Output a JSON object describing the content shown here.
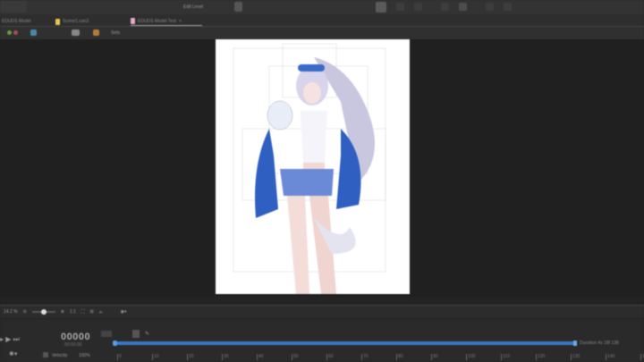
{
  "toolbar": {
    "edit_level": "Edit Level"
  },
  "tabs": [
    {
      "label": "EDUDS Model",
      "color": "#888888"
    },
    {
      "label": "Scene1.can3",
      "color": "#e8c84a"
    },
    {
      "label": "EDUDS Model Test",
      "color": "#e8a8c8",
      "active": true
    }
  ],
  "subbar": {
    "label": "Sets"
  },
  "zoombar": {
    "zoom": "14.2 %",
    "actual_size": "1:1"
  },
  "timeline": {
    "frame": "00000",
    "time": "00:00:00",
    "velocity_label": "Velocity",
    "velocity": "100%",
    "duration": "Duration 4s 18f  138",
    "ticks": [
      "0",
      "10",
      "20",
      "30",
      "40",
      "50",
      "60",
      "70",
      "80",
      "90",
      "100",
      "110",
      "120",
      "130",
      "140",
      "150"
    ]
  },
  "colors": {
    "accent": "#3a78c6",
    "canvas": "#ffffff",
    "background": "#202020"
  }
}
